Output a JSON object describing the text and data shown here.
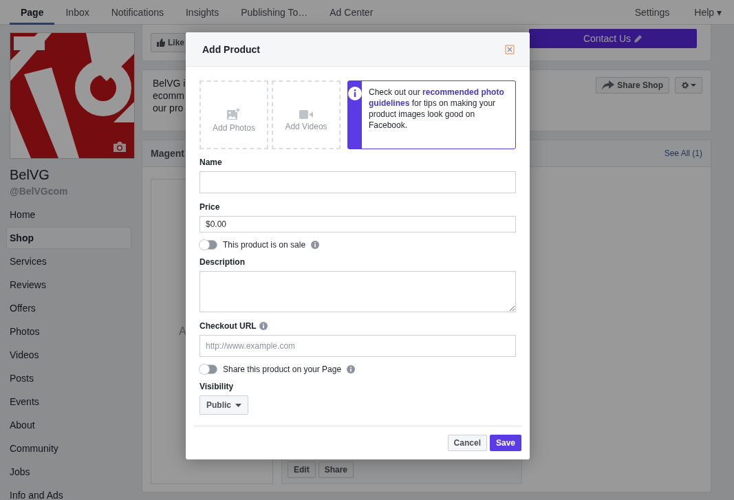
{
  "nav": {
    "tabs": [
      {
        "label": "Page",
        "selected": true
      },
      {
        "label": "Inbox",
        "selected": false
      },
      {
        "label": "Notifications",
        "selected": false
      },
      {
        "label": "Insights",
        "selected": false
      },
      {
        "label": "Publishing To…",
        "selected": false
      },
      {
        "label": "Ad Center",
        "selected": false
      }
    ],
    "right": [
      "Settings",
      "Help ▾"
    ]
  },
  "sidebar": {
    "name": "BelVG",
    "handle": "@BelVGcom",
    "items": [
      {
        "label": "Home",
        "selected": false
      },
      {
        "label": "Shop",
        "selected": true
      },
      {
        "label": "Services",
        "selected": false
      },
      {
        "label": "Reviews",
        "selected": false
      },
      {
        "label": "Offers",
        "selected": false
      },
      {
        "label": "Photos",
        "selected": false
      },
      {
        "label": "Videos",
        "selected": false
      },
      {
        "label": "Posts",
        "selected": false
      },
      {
        "label": "Events",
        "selected": false
      },
      {
        "label": "About",
        "selected": false
      },
      {
        "label": "Community",
        "selected": false
      },
      {
        "label": "Jobs",
        "selected": false
      },
      {
        "label": "Info and Ads",
        "selected": false
      }
    ]
  },
  "main": {
    "like_button": "Like",
    "contact_button": "Contact Us",
    "about_lines": [
      "BelVG i",
      "ecomm",
      "our pro"
    ],
    "share_button": "Share Shop",
    "section_title": "Magent",
    "see_all": "See All (1)",
    "product_fragment": "A",
    "product_buttons": [
      "Edit",
      "Share"
    ]
  },
  "modal": {
    "title": "Add Product",
    "media": [
      "Add Photos",
      "Add Videos"
    ],
    "tip": "Check out our **recommended photo guidelines** for tips on making your product images look good on Facebook.",
    "fields": [
      {
        "kind": "text",
        "label": "Name"
      },
      {
        "kind": "small",
        "label": "Price",
        "value": "$0.00"
      },
      {
        "kind": "toggle",
        "label": "This product is on sale",
        "on": false
      },
      {
        "kind": "textarea",
        "label": "Description"
      },
      {
        "kind": "text",
        "label": "Checkout URL",
        "info": true,
        "placeholder": "http://www.example.com"
      },
      {
        "kind": "toggle",
        "label": "Share this product on your Page",
        "on": false
      },
      {
        "kind": "select",
        "label": "Visibility",
        "value": "Public"
      }
    ],
    "buttons": [
      {
        "label": "Cancel",
        "kind": "secondary"
      },
      {
        "label": "Save",
        "kind": "primary"
      }
    ]
  }
}
